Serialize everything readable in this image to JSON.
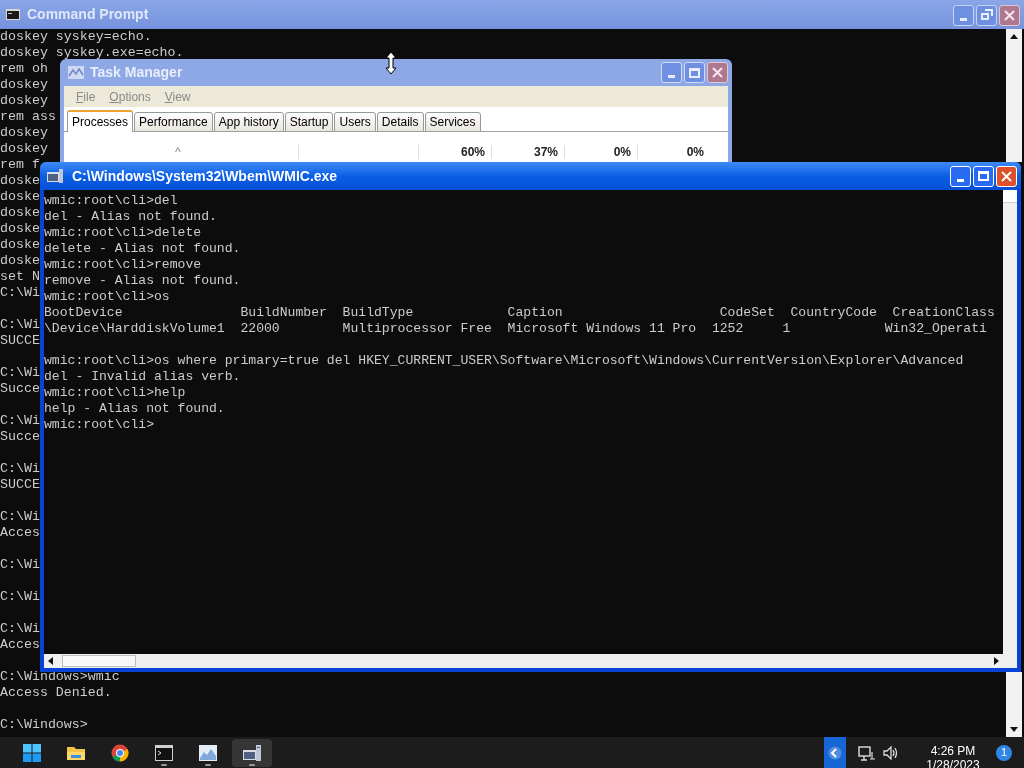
{
  "command_prompt": {
    "title": "Command Prompt",
    "blocks": [
      [
        "doskey syskey=echo.",
        "doskey syskey.exe=echo.",
        "rem oh",
        "doskey",
        "doskey",
        "rem ass",
        "doskey",
        "doskey",
        "rem f",
        "doske",
        "doske",
        "doske",
        "doske",
        "doske",
        "doske",
        "set N",
        "C:\\Wi"
      ],
      [
        "C:\\Wi",
        "SUCCE"
      ],
      [
        "C:\\Wi",
        "Succe"
      ],
      [
        "C:\\Wi",
        "Succe"
      ],
      [
        "C:\\Wi",
        "SUCCE"
      ],
      [
        "C:\\Wi",
        "Acces"
      ],
      [
        "C:\\Wi"
      ],
      [
        "C:\\Wi"
      ],
      [
        "C:\\Wi",
        "Acces"
      ],
      [
        "C:\\Windows>wmic",
        "Access Denied."
      ],
      [
        "C:\\Windows>"
      ]
    ]
  },
  "task_manager": {
    "title": "Task Manager",
    "menu": [
      {
        "label": "File"
      },
      {
        "label": "Options"
      },
      {
        "label": "View"
      }
    ],
    "tabs": [
      {
        "label": "Processes",
        "selected": true
      },
      {
        "label": "Performance",
        "selected": false
      },
      {
        "label": "App history",
        "selected": false
      },
      {
        "label": "Startup",
        "selected": false
      },
      {
        "label": "Users",
        "selected": false
      },
      {
        "label": "Details",
        "selected": false
      },
      {
        "label": "Services",
        "selected": false
      }
    ],
    "sort_indicator": "^",
    "column_headers": [
      "60%",
      "37%",
      "0%",
      "0%"
    ]
  },
  "wmic_window": {
    "title": "C:\\Windows\\System32\\Wbem\\WMIC.exe",
    "blocks": [
      [
        "wmic:root\\cli>del",
        "del - Alias not found.",
        "wmic:root\\cli>delete",
        "delete - Alias not found.",
        "wmic:root\\cli>remove",
        "remove - Alias not found.",
        "wmic:root\\cli>os",
        "BootDevice               BuildNumber  BuildType            Caption                    CodeSet  CountryCode  CreationClass",
        "\\Device\\HarddiskVolume1  22000        Multiprocessor Free  Microsoft Windows 11 Pro  1252     1            Win32_Operati"
      ],
      [
        "wmic:root\\cli>os where primary=true del HKEY_CURRENT_USER\\Software\\Microsoft\\Windows\\CurrentVersion\\Explorer\\Advanced",
        "del - Invalid alias verb.",
        "wmic:root\\cli>help",
        "help - Alias not found.",
        "wmic:root\\cli>"
      ]
    ]
  },
  "taskbar": {
    "apps": [
      {
        "kind": "start",
        "running": false,
        "selected": false
      },
      {
        "kind": "folder",
        "running": false,
        "selected": false
      },
      {
        "kind": "browser",
        "running": false,
        "selected": false
      },
      {
        "kind": "terminal",
        "running": true,
        "selected": false
      },
      {
        "kind": "monitor",
        "running": true,
        "selected": false
      },
      {
        "kind": "wmic",
        "running": true,
        "selected": true
      }
    ],
    "time": "4:26 PM",
    "date": "1/28/2023",
    "notification_count": "1"
  }
}
